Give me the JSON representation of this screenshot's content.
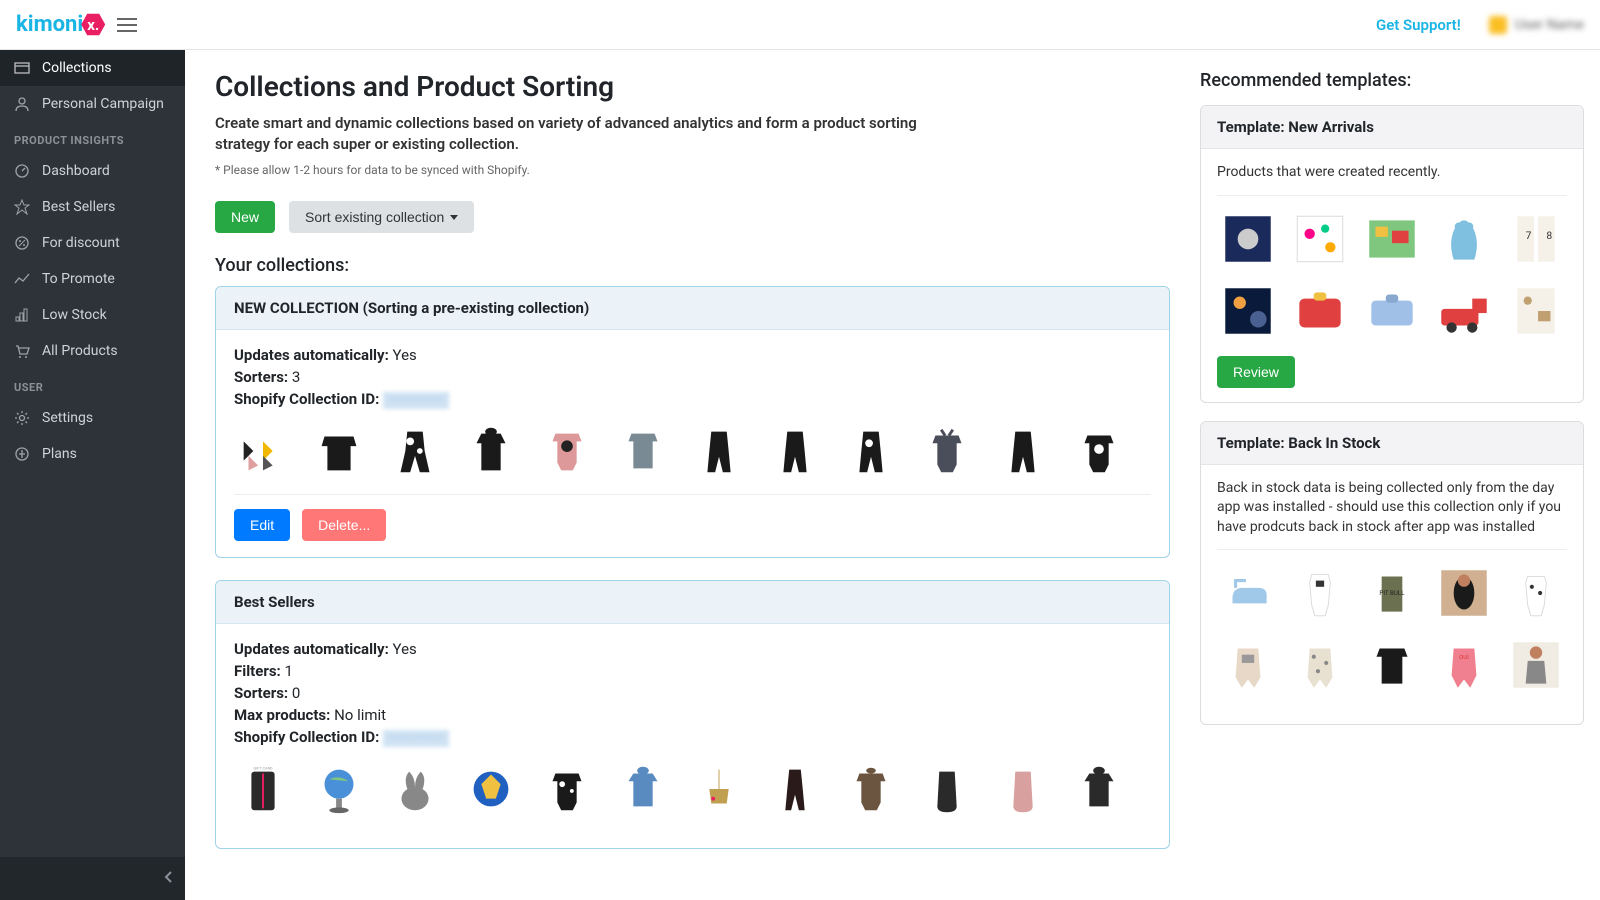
{
  "topbar": {
    "logo_text": "kimoni",
    "logo_x": "x.",
    "support": "Get Support!",
    "user_name": "User Name"
  },
  "sidebar": {
    "items": [
      {
        "label": "Collections",
        "icon": "collections"
      },
      {
        "label": "Personal Campaign",
        "icon": "user"
      }
    ],
    "section1": "PRODUCT INSIGHTS",
    "insights": [
      {
        "label": "Dashboard",
        "icon": "dashboard"
      },
      {
        "label": "Best Sellers",
        "icon": "star"
      },
      {
        "label": "For discount",
        "icon": "percent"
      },
      {
        "label": "To Promote",
        "icon": "trend"
      },
      {
        "label": "Low Stock",
        "icon": "stock"
      },
      {
        "label": "All Products",
        "icon": "cart"
      }
    ],
    "section2": "USER",
    "user_items": [
      {
        "label": "Settings",
        "icon": "gear"
      },
      {
        "label": "Plans",
        "icon": "plans"
      }
    ]
  },
  "page": {
    "title": "Collections and Product Sorting",
    "desc": "Create smart and dynamic collections based on variety of advanced analytics and form a product sorting strategy for each super or existing collection.",
    "note": "* Please allow 1-2 hours for data to be synced with Shopify.",
    "new_btn": "New",
    "sort_btn": "Sort existing collection",
    "your_collections": "Your collections:"
  },
  "collections": [
    {
      "title": "NEW COLLECTION (Sorting a pre-existing collection)",
      "updates_label": "Updates automatically:",
      "updates_value": "Yes",
      "sorters_label": "Sorters:",
      "sorters_value": "3",
      "id_label": "Shopify Collection ID:",
      "id_value": "················",
      "edit": "Edit",
      "delete": "Delete..."
    },
    {
      "title": "Best Sellers",
      "updates_label": "Updates automatically:",
      "updates_value": "Yes",
      "filters_label": "Filters:",
      "filters_value": "1",
      "sorters_label": "Sorters:",
      "sorters_value": "0",
      "max_label": "Max products:",
      "max_value": "No limit",
      "id_label": "Shopify Collection ID:",
      "id_value": "················"
    }
  ],
  "recommended": {
    "title": "Recommended templates:",
    "templates": [
      {
        "header": "Template: New Arrivals",
        "desc": "Products that were created recently.",
        "review": "Review"
      },
      {
        "header": "Template: Back In Stock",
        "desc": "Back in stock data is being collected only from the day app was installed - should use this collection only if you have prodcuts back in stock after app was installed"
      }
    ]
  }
}
